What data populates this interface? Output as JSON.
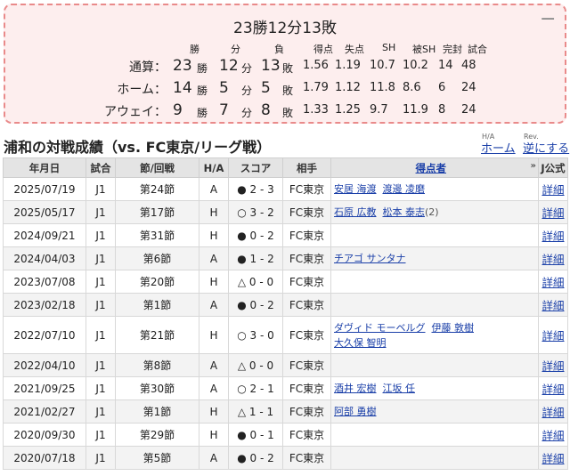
{
  "summary": {
    "title": "23勝12分13敗",
    "collapse_glyph": "−",
    "headers": [
      "勝",
      "分",
      "負",
      "得点",
      "失点",
      "SH",
      "被SH",
      "完封",
      "試合"
    ],
    "rows": [
      {
        "label": "通算：",
        "win": "23",
        "draw": "12",
        "loss": "13",
        "win_unit": "勝",
        "draw_unit": "分",
        "loss_unit": "敗",
        "gf": "1.56",
        "ga": "1.19",
        "sh": "10.7",
        "osh": "10.2",
        "cs": "14",
        "games": "48"
      },
      {
        "label": "ホーム：",
        "win": "14",
        "draw": "5",
        "loss": "5",
        "win_unit": "勝",
        "draw_unit": "分",
        "loss_unit": "敗",
        "gf": "1.79",
        "ga": "1.12",
        "sh": "11.8",
        "osh": "8.6",
        "cs": "6",
        "games": "24"
      },
      {
        "label": "アウェイ：",
        "win": "9",
        "draw": "7",
        "loss": "8",
        "win_unit": "勝",
        "draw_unit": "分",
        "loss_unit": "敗",
        "gf": "1.33",
        "ga": "1.25",
        "sh": "9.7",
        "osh": "11.9",
        "cs": "8",
        "games": "24"
      }
    ]
  },
  "page": {
    "title": "浦和の対戦成績（vs. FC東京/リーグ戦）",
    "ha_small": "H/A",
    "rev_small": "Rev.",
    "home_link": "ホーム",
    "reverse_link": "逆にする"
  },
  "table": {
    "headers": {
      "date": "年月日",
      "comp": "試合",
      "round": "節/回戦",
      "ha": "H/A",
      "score": "スコア",
      "opponent": "相手",
      "scorers": "得点者",
      "sort": "»",
      "official": "J公式"
    },
    "detail_label": "詳細",
    "rows": [
      {
        "date": "2025/07/19",
        "comp": "J1",
        "round": "第24節",
        "ha": "A",
        "score": "● 2 - 3",
        "opp": "FC東京",
        "scorers": [
          {
            "name": "安居 海渡"
          },
          {
            "name": "渡邊 凌磨"
          }
        ]
      },
      {
        "date": "2025/05/17",
        "comp": "J1",
        "round": "第17節",
        "ha": "H",
        "score": "○ 3 - 2",
        "opp": "FC東京",
        "scorers": [
          {
            "name": "石原 広教"
          },
          {
            "name": "松本 泰志",
            "count": "(2)"
          }
        ]
      },
      {
        "date": "2024/09/21",
        "comp": "J1",
        "round": "第31節",
        "ha": "H",
        "score": "● 0 - 2",
        "opp": "FC東京",
        "scorers": []
      },
      {
        "date": "2024/04/03",
        "comp": "J1",
        "round": "第6節",
        "ha": "A",
        "score": "● 1 - 2",
        "opp": "FC東京",
        "scorers": [
          {
            "name": "チアゴ サンタナ"
          }
        ]
      },
      {
        "date": "2023/07/08",
        "comp": "J1",
        "round": "第20節",
        "ha": "H",
        "score": "△ 0 - 0",
        "opp": "FC東京",
        "scorers": []
      },
      {
        "date": "2023/02/18",
        "comp": "J1",
        "round": "第1節",
        "ha": "A",
        "score": "● 0 - 2",
        "opp": "FC東京",
        "scorers": []
      },
      {
        "date": "2022/07/10",
        "comp": "J1",
        "round": "第21節",
        "ha": "H",
        "score": "○ 3 - 0",
        "opp": "FC東京",
        "tall": true,
        "scorers": [
          {
            "name": "ダヴィド モーベルグ"
          },
          {
            "name": "伊藤 敦樹"
          },
          {
            "name": "大久保 智明"
          }
        ]
      },
      {
        "date": "2022/04/10",
        "comp": "J1",
        "round": "第8節",
        "ha": "A",
        "score": "△ 0 - 0",
        "opp": "FC東京",
        "scorers": []
      },
      {
        "date": "2021/09/25",
        "comp": "J1",
        "round": "第30節",
        "ha": "A",
        "score": "○ 2 - 1",
        "opp": "FC東京",
        "scorers": [
          {
            "name": "酒井 宏樹"
          },
          {
            "name": "江坂 任"
          }
        ]
      },
      {
        "date": "2021/02/27",
        "comp": "J1",
        "round": "第1節",
        "ha": "H",
        "score": "△ 1 - 1",
        "opp": "FC東京",
        "scorers": [
          {
            "name": "阿部 勇樹"
          }
        ]
      },
      {
        "date": "2020/09/30",
        "comp": "J1",
        "round": "第29節",
        "ha": "H",
        "score": "● 0 - 1",
        "opp": "FC東京",
        "scorers": []
      },
      {
        "date": "2020/07/18",
        "comp": "J1",
        "round": "第5節",
        "ha": "A",
        "score": "● 0 - 2",
        "opp": "FC東京",
        "scorers": []
      }
    ]
  }
}
